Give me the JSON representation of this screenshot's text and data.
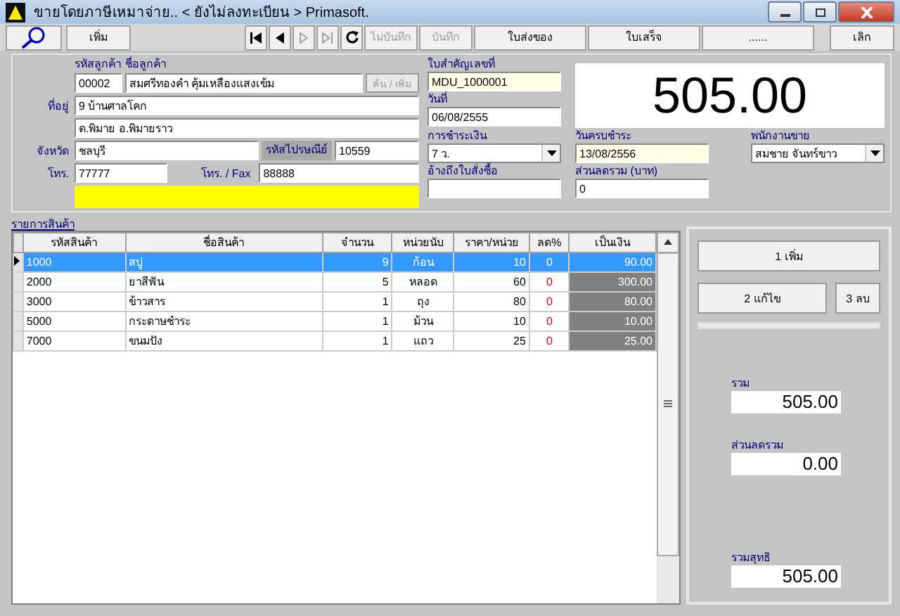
{
  "window": {
    "title": "ขายโดยภาษีเหมาจ่าย.. < ยังไม่ลงทะเบียน > Primasoft."
  },
  "toolbar": [
    {
      "kind": "icon",
      "disabled": false
    },
    {
      "kind": "text",
      "label": "เพิ่ม",
      "disabled": false
    },
    {
      "kind": "icon",
      "disabled": false
    },
    {
      "kind": "icon",
      "disabled": false
    },
    {
      "kind": "icon",
      "disabled": true
    },
    {
      "kind": "icon",
      "disabled": true
    },
    {
      "kind": "icon",
      "disabled": false
    },
    {
      "kind": "text",
      "label": "ไม่บันทึก",
      "disabled": true
    },
    {
      "kind": "text",
      "label": "บันทึก",
      "disabled": true
    },
    {
      "kind": "text",
      "label": "ใบส่งของ",
      "disabled": false
    },
    {
      "kind": "text",
      "label": "ใบเสร็จ",
      "disabled": false
    },
    {
      "kind": "text",
      "label": "......",
      "disabled": false
    },
    {
      "kind": "spacer"
    },
    {
      "kind": "text",
      "label": "เลิก",
      "disabled": false
    }
  ],
  "customer": {
    "code_label": "รหัสลูกค้า",
    "name_label": "ชื่อลูกค้า",
    "code": "00002",
    "name": "สมศรีทองคำ คุ้มเหลืองแสงเข้ม",
    "lookup_button": {
      "label": "ค้น / เพิ่ม",
      "disabled": true
    },
    "address_label": "ที่อยู่",
    "address_lines": [
      "9 บ้านศาลโคก",
      "ต.พิมาย อ.พิมายราว"
    ],
    "province_label": "จังหวัด",
    "province": "ชลบุรี",
    "postcode_label": "รหัสไปรษณีย์",
    "postcode": "10559",
    "phone_label": "โทร.",
    "phone": "77777",
    "fax_label": "โทร. / Fax",
    "fax": "88888"
  },
  "document": {
    "number_label": "ใบสำคัญเลขที่",
    "number": "MDU_1000001",
    "date_label": "วันที่",
    "date": "06/08/2555"
  },
  "total_display": "505.00",
  "payment": {
    "label": "การชำระเงิน",
    "value": "7 ว."
  },
  "due_date": {
    "label": "วันครบชำระ",
    "value": "13/08/2556"
  },
  "salesperson": {
    "label": "พนักงานขาย",
    "value": "สมชาย จันทร์ขาว"
  },
  "po_ref": {
    "label": "อ้างถึงใบสั่งซื้อ"
  },
  "discount": {
    "label": "ส่วนลดรวม (บาท)",
    "value": "0"
  },
  "items": {
    "title": "รายการสินค้า",
    "columns": [
      "รหัสสินค้า",
      "ชื่อสินค้า",
      "จำนวน",
      "หน่วยนับ",
      "ราคา/หน่วย",
      "ลด%",
      "เป็นเงิน"
    ],
    "rows": [
      {
        "cells": [
          "1000",
          "สบู่",
          "9",
          "ก้อน",
          "10",
          "0",
          "90.00"
        ],
        "selected": true
      },
      {
        "cells": [
          "2000",
          "ยาสีฟัน",
          "5",
          "หลอด",
          "60",
          "0",
          "300.00"
        ],
        "selected": false
      },
      {
        "cells": [
          "3000",
          "ข้าวสาร",
          "1",
          "ถุง",
          "80",
          "0",
          "80.00"
        ],
        "selected": false
      },
      {
        "cells": [
          "5000",
          "กระดาษชำระ",
          "1",
          "ม้วน",
          "10",
          "0",
          "10.00"
        ],
        "selected": false
      },
      {
        "cells": [
          "7000",
          "ขนมปัง",
          "1",
          "แถว",
          "25",
          "0",
          "25.00"
        ],
        "selected": false
      }
    ]
  },
  "actions": [
    {
      "label": "1 เพิ่ม"
    },
    {
      "label": "2 แก้ไข"
    },
    {
      "label": "3 ลบ"
    }
  ],
  "summary": [
    {
      "label": "รวม",
      "value": "505.00"
    },
    {
      "label": "ส่วนลดรวม",
      "value": "0.00"
    },
    {
      "label": "รวมสุทธิ",
      "value": "505.00"
    }
  ]
}
